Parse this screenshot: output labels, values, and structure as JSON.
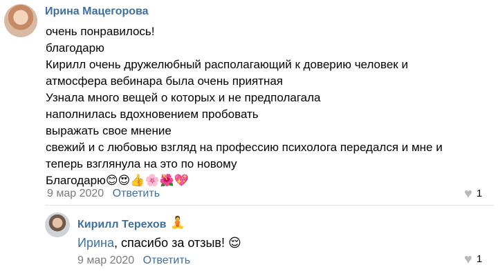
{
  "comment": {
    "author": "Ирина Мацегорова",
    "lines": [
      "очень понравилось!",
      "благодарю",
      "Кирилл очень дружелюбный располагающий к доверию человек и",
      "атмосфера вебинара была очень приятная",
      "Узнала много вещей о которых и не предполагала",
      "наполнилась вдохновением пробовать",
      "выражать свое мнение",
      "свежий и с любовью взгляд на профессию психолога передался и мне и",
      "теперь взглянула на это по новому"
    ],
    "last_line": "Благодарю",
    "emojis": "😊😍👍🌸🌺💖",
    "date": "9 мар 2020",
    "reply_label": "Ответить",
    "like_count": "1"
  },
  "reply": {
    "author": "Кирилл Терехов",
    "author_badge": "🧘",
    "mention": "Ирина",
    "text": ", спасибо за отзыв!",
    "emoji": "😌",
    "date": "9 мар 2020",
    "reply_label": "Ответить",
    "like_count": "1"
  },
  "icons": {
    "like": "heart-icon"
  }
}
